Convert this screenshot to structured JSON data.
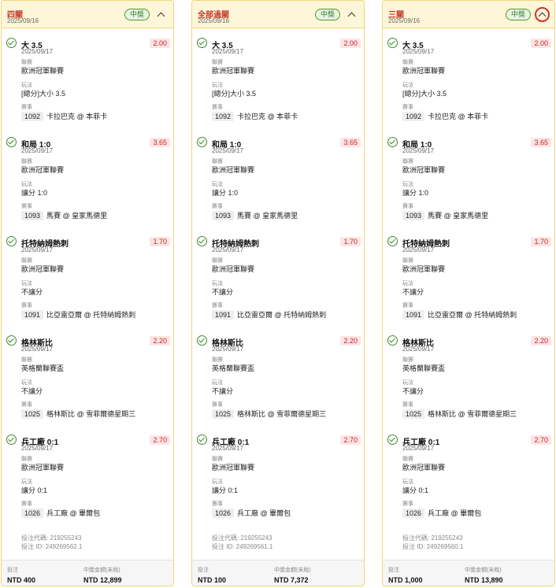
{
  "cards": [
    {
      "title": "四關",
      "date": "2025/09/16",
      "badge": "中獎",
      "bets": [
        {
          "selection": "大 3.5",
          "date": "2025/09/17",
          "odds": "2.00",
          "league_label": "聯賽",
          "league": "歐洲冠軍聯賽",
          "play_label": "玩法",
          "play": "[總分]大小 3.5",
          "event_label": "賽事",
          "code": "1092",
          "match": "卡拉巴克 @ 本菲卡"
        },
        {
          "selection": "和局 1:0",
          "date": "2025/09/17",
          "odds": "3.65",
          "league_label": "聯賽",
          "league": "歐洲冠軍聯賽",
          "play_label": "玩法",
          "play": "讓分 1:0",
          "event_label": "賽事",
          "code": "1093",
          "match": "馬賽 @ 皇家馬德里"
        },
        {
          "selection": "托特納姆熱刺",
          "date": "2025/09/17",
          "odds": "1.70",
          "league_label": "聯賽",
          "league": "歐洲冠軍聯賽",
          "play_label": "玩法",
          "play": "不讓分",
          "event_label": "賽事",
          "code": "1091",
          "match": "比亞雷亞爾 @ 托特納姆熱刺"
        },
        {
          "selection": "格林斯比",
          "date": "2025/09/17",
          "odds": "2.20",
          "league_label": "聯賽",
          "league": "英格蘭聯賽盃",
          "play_label": "玩法",
          "play": "不讓分",
          "event_label": "賽事",
          "code": "1025",
          "match": "格林斯比 @ 雪菲爾德星期三"
        },
        {
          "selection": "兵工廠 0:1",
          "date": "2025/09/17",
          "odds": "2.70",
          "league_label": "聯賽",
          "league": "歐洲冠軍聯賽",
          "play_label": "玩法",
          "play": "讓分 0:1",
          "event_label": "賽事",
          "code": "1026",
          "match": "兵工廠 @ 畢爾包"
        }
      ],
      "bet_code": "投注代碼: 219255243",
      "bet_id": "投注 ID: 249269562.1",
      "stake_label": "投注",
      "stake": "NTD 400",
      "payout_label": "中獎金額(未稅)",
      "payout": "NTD 12,899"
    },
    {
      "title": "全部過關",
      "date": "2025/09/16",
      "badge": "中獎",
      "bets": [
        {
          "selection": "大 3.5",
          "date": "2025/09/17",
          "odds": "2.00",
          "league_label": "聯賽",
          "league": "歐洲冠軍聯賽",
          "play_label": "玩法",
          "play": "[總分]大小 3.5",
          "event_label": "賽事",
          "code": "1092",
          "match": "卡拉巴克 @ 本菲卡"
        },
        {
          "selection": "和局 1:0",
          "date": "2025/09/17",
          "odds": "3.65",
          "league_label": "聯賽",
          "league": "歐洲冠軍聯賽",
          "play_label": "玩法",
          "play": "讓分 1:0",
          "event_label": "賽事",
          "code": "1093",
          "match": "馬賽 @ 皇家馬德里"
        },
        {
          "selection": "托特納姆熱刺",
          "date": "2025/09/17",
          "odds": "1.70",
          "league_label": "聯賽",
          "league": "歐洲冠軍聯賽",
          "play_label": "玩法",
          "play": "不讓分",
          "event_label": "賽事",
          "code": "1091",
          "match": "比亞雷亞爾 @ 托特納姆熱刺"
        },
        {
          "selection": "格林斯比",
          "date": "2025/09/17",
          "odds": "2.20",
          "league_label": "聯賽",
          "league": "英格蘭聯賽盃",
          "play_label": "玩法",
          "play": "不讓分",
          "event_label": "賽事",
          "code": "1025",
          "match": "格林斯比 @ 雪菲爾德星期三"
        },
        {
          "selection": "兵工廠 0:1",
          "date": "2025/09/17",
          "odds": "2.70",
          "league_label": "聯賽",
          "league": "歐洲冠軍聯賽",
          "play_label": "玩法",
          "play": "讓分 0:1",
          "event_label": "賽事",
          "code": "1026",
          "match": "兵工廠 @ 畢爾包"
        }
      ],
      "bet_code": "投注代碼: 219255243",
      "bet_id": "投注 ID: 249269561.1",
      "stake_label": "投注",
      "stake": "NTD 100",
      "payout_label": "中獎金額(未稅)",
      "payout": "NTD 7,372"
    },
    {
      "title": "三關",
      "date": "2025/09/16",
      "badge": "中獎",
      "bets": [
        {
          "selection": "大 3.5",
          "date": "2025/09/17",
          "odds": "2.00",
          "league_label": "聯賽",
          "league": "歐洲冠軍聯賽",
          "play_label": "玩法",
          "play": "[總分]大小 3.5",
          "event_label": "賽事",
          "code": "1092",
          "match": "卡拉巴克 @ 本菲卡"
        },
        {
          "selection": "和局 1:0",
          "date": "2025/09/17",
          "odds": "3.65",
          "league_label": "聯賽",
          "league": "歐洲冠軍聯賽",
          "play_label": "玩法",
          "play": "讓分 1:0",
          "event_label": "賽事",
          "code": "1093",
          "match": "馬賽 @ 皇家馬德里"
        },
        {
          "selection": "托特納姆熱刺",
          "date": "2025/09/17",
          "odds": "1.70",
          "league_label": "聯賽",
          "league": "歐洲冠軍聯賽",
          "play_label": "玩法",
          "play": "不讓分",
          "event_label": "賽事",
          "code": "1091",
          "match": "比亞雷亞爾 @ 托特納姆熱刺"
        },
        {
          "selection": "格林斯比",
          "date": "2025/09/17",
          "odds": "2.20",
          "league_label": "聯賽",
          "league": "英格蘭聯賽盃",
          "play_label": "玩法",
          "play": "不讓分",
          "event_label": "賽事",
          "code": "1025",
          "match": "格林斯比 @ 雪菲爾德星期三"
        },
        {
          "selection": "兵工廠 0:1",
          "date": "2025/09/17",
          "odds": "2.70",
          "league_label": "聯賽",
          "league": "歐洲冠軍聯賽",
          "play_label": "玩法",
          "play": "讓分 0:1",
          "event_label": "賽事",
          "code": "1026",
          "match": "兵工廠 @ 畢爾包"
        }
      ],
      "bet_code": "投注代碼: 219255243",
      "bet_id": "投注 ID: 249269560.1",
      "stake_label": "投注",
      "stake": "NTD 1,000",
      "payout_label": "中獎金額(未稅)",
      "payout": "NTD 13,890"
    }
  ]
}
